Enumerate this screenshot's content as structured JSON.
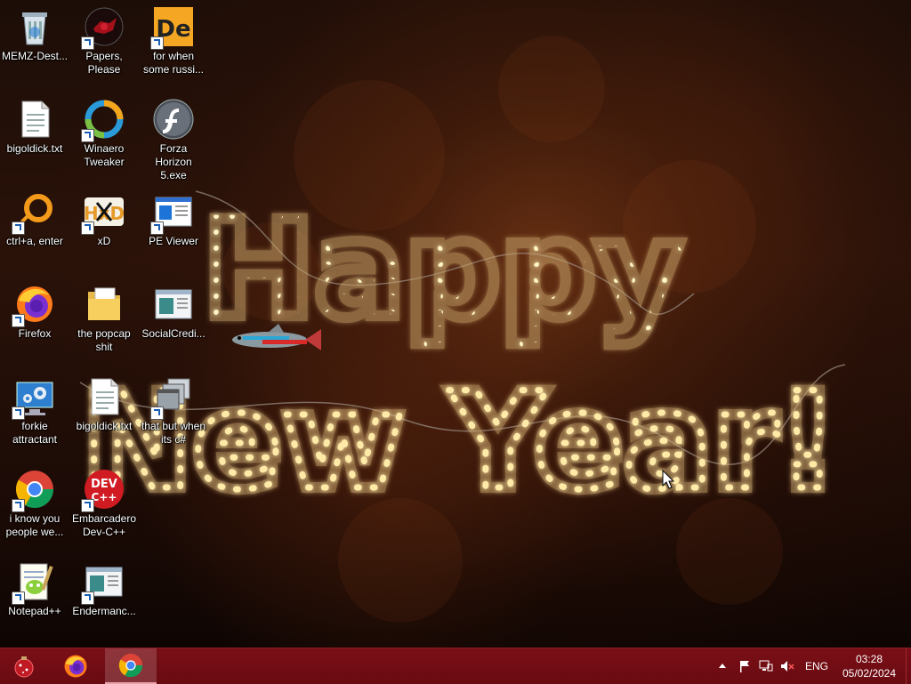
{
  "desktop": {
    "greeting": {
      "line1": "Happy",
      "line2": "New Year!"
    },
    "icons": [
      {
        "label": "MEMZ-Dest...",
        "icon": "recycle-bin-icon"
      },
      {
        "label": "Papers, Please",
        "icon": "papers-please-icon"
      },
      {
        "label": "for when some russi...",
        "icon": "de-app-icon"
      },
      {
        "label": "bigoldick.txt",
        "icon": "text-file-icon"
      },
      {
        "label": "Winaero Tweaker",
        "icon": "winaero-tweaker-icon"
      },
      {
        "label": "Forza Horizon 5.exe",
        "icon": "flash-player-icon"
      },
      {
        "label": "ctrl+a, enter",
        "icon": "orange-ring-icon"
      },
      {
        "label": "xD",
        "icon": "hxd-icon"
      },
      {
        "label": "PE Viewer",
        "icon": "pe-viewer-icon"
      },
      {
        "label": "Firefox",
        "icon": "firefox-icon"
      },
      {
        "label": "the popcap shit",
        "icon": "folder-icon"
      },
      {
        "label": "SocialCredi...",
        "icon": "window-app-icon"
      },
      {
        "label": "forkie attractant",
        "icon": "settings-monitor-icon"
      },
      {
        "label": "bigoldick.txt",
        "icon": "text-file-icon"
      },
      {
        "label": "that but when its c#",
        "icon": "stacked-windows-icon"
      },
      {
        "label": "i know you people we...",
        "icon": "chrome-icon"
      },
      {
        "label": "Embarcadero Dev-C++",
        "icon": "dev-cpp-icon"
      },
      {
        "label": "Notepad++",
        "icon": "notepad-plus-plus-icon"
      },
      {
        "label": "Endermanc...",
        "icon": "window-app-icon"
      }
    ],
    "devcpp_text": {
      "top": "DEV",
      "bottom": "C++"
    },
    "hxd_text": "HxD",
    "de_text": "De"
  },
  "taskbar": {
    "pinned": [
      {
        "name": "start-button",
        "icon": "ornament-start-icon"
      },
      {
        "name": "firefox",
        "icon": "firefox-icon"
      },
      {
        "name": "chrome",
        "icon": "chrome-icon",
        "active": true
      }
    ],
    "tray": {
      "chevron": "show-hidden-icons",
      "flag": "action-center-flag-icon",
      "network": "network-icon",
      "volume": "volume-muted-icon",
      "language": "ENG",
      "time": "03:28",
      "date": "05/02/2024"
    }
  },
  "colors": {
    "taskbar": "#700d14",
    "bulb": "#ffe9a0",
    "tube": "#c9a46a",
    "label_text": "#ffffff"
  }
}
